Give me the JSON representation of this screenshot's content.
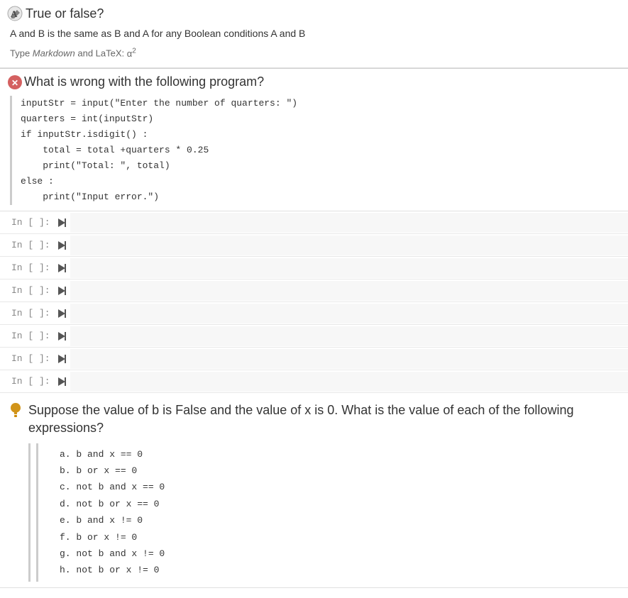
{
  "truefalse": {
    "icon": "🅰",
    "title": "True or false?",
    "body_text": "A and B is the same as B and A for any Boolean conditions A and B",
    "markdown_note_prefix": "Type ",
    "markdown_label": "Markdown",
    "markdown_note_mid": " and LaTeX: ",
    "latex_example": "α²"
  },
  "wrongprogram": {
    "title": "What is wrong with the following program?",
    "code_lines": [
      "inputStr = input(\"Enter the number of quarters: \")",
      "quarters = int(inputStr)",
      "if inputStr.isdigit() :",
      "    total = total +quarters * 0.25",
      "    print(\"Total: \", total)",
      "else :",
      "    print(\"Input error.\")"
    ]
  },
  "input_cells": [
    {
      "label": "In [ ]:",
      "id": "cell-1"
    },
    {
      "label": "In [ ]:",
      "id": "cell-2"
    },
    {
      "label": "In [ ]:",
      "id": "cell-3"
    },
    {
      "label": "In [ ]:",
      "id": "cell-4"
    },
    {
      "label": "In [ ]:",
      "id": "cell-5"
    },
    {
      "label": "In [ ]:",
      "id": "cell-6"
    },
    {
      "label": "In [ ]:",
      "id": "cell-7"
    },
    {
      "label": "In [ ]:",
      "id": "cell-8"
    }
  ],
  "suppose": {
    "title": "Suppose the value of b is False and the value of x is 0. What is the value of each of the following expressions?",
    "expressions": [
      "a.  b and x == 0",
      "b.  b or x == 0",
      "c.  not b and x == 0",
      "d.  not b or x == 0",
      "e.  b and x != 0",
      "f.  b or x != 0",
      "g.  not b and x != 0",
      "h.  not b or x != 0"
    ]
  },
  "icons": {
    "run_arrow": "▶|"
  }
}
